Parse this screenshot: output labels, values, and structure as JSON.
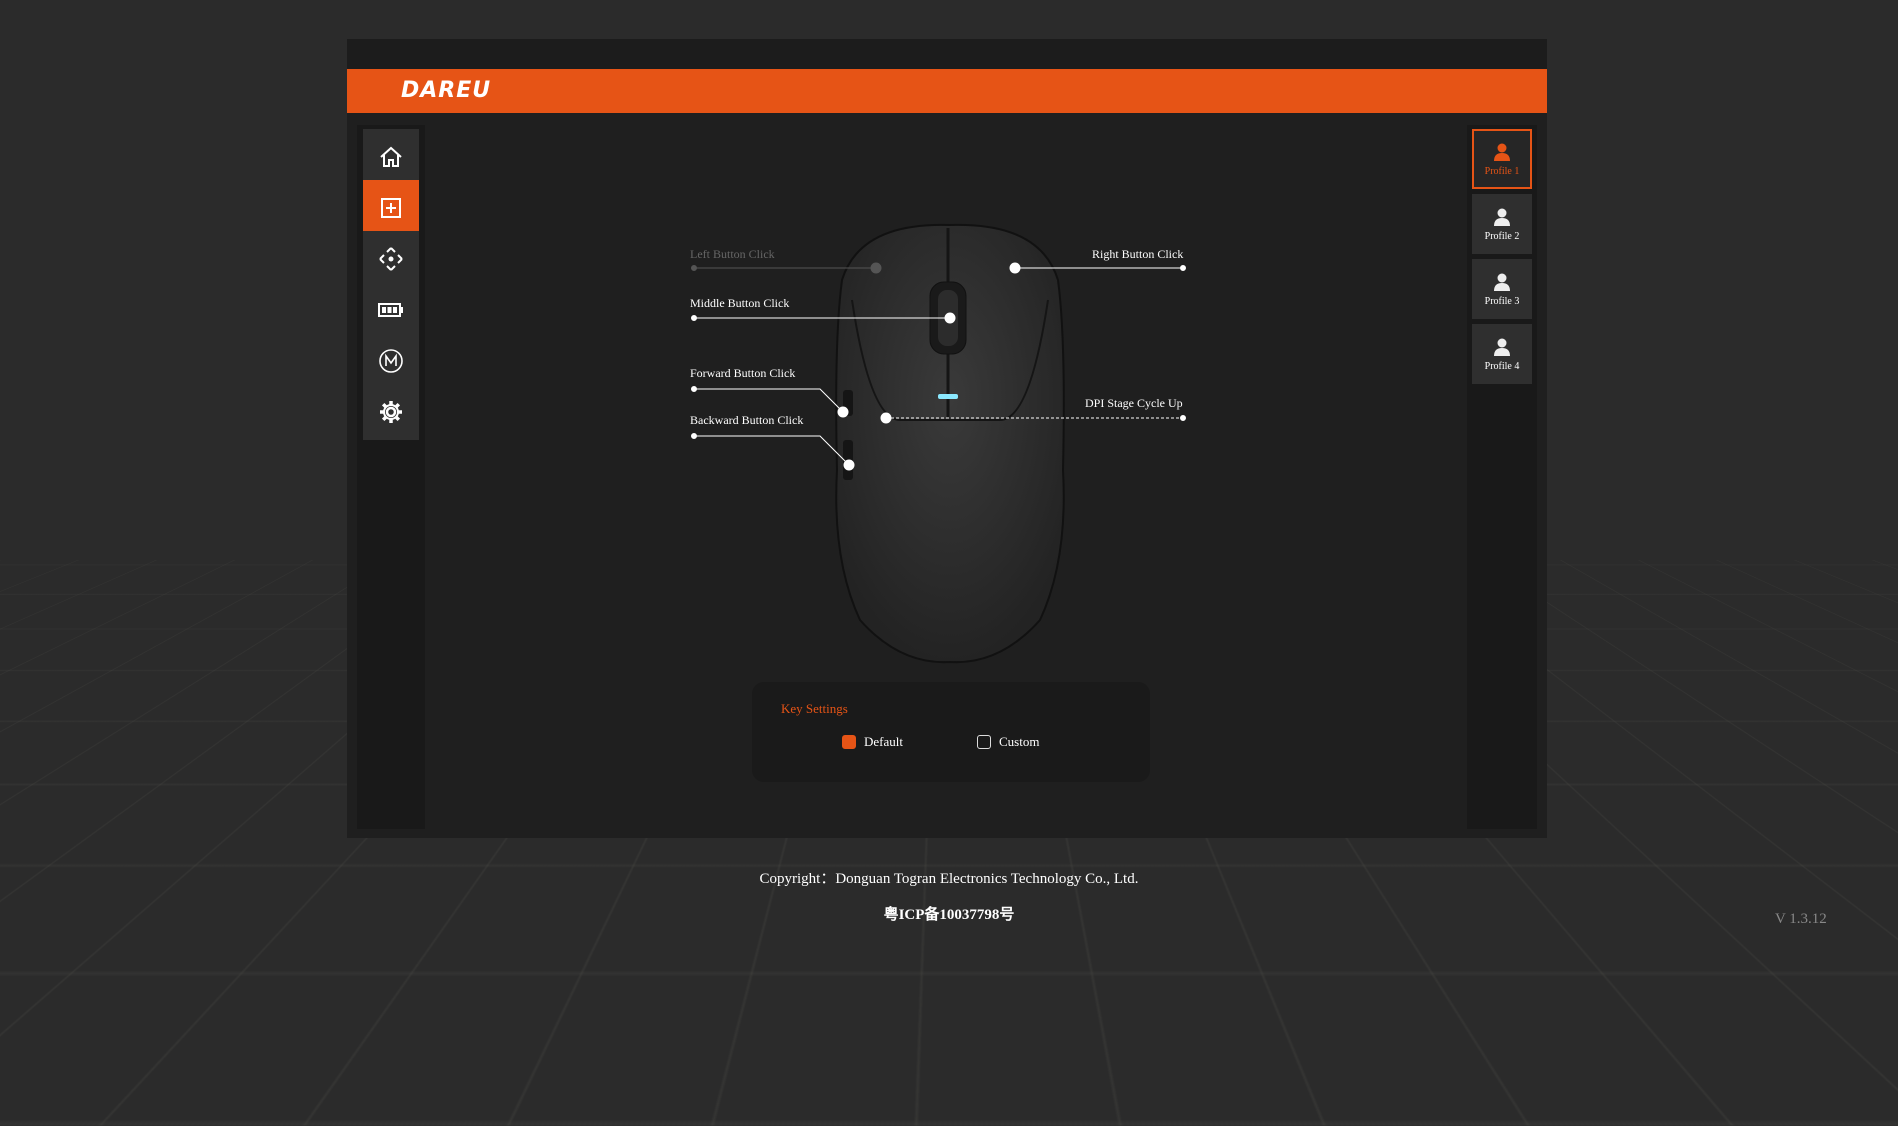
{
  "brand": {
    "logo_text": "DAREU",
    "accent_color": "#e65416"
  },
  "left_nav": [
    {
      "name": "home-icon",
      "active": false
    },
    {
      "name": "key-assign-icon",
      "active": true
    },
    {
      "name": "dpi-icon",
      "active": false
    },
    {
      "name": "battery-icon",
      "active": false
    },
    {
      "name": "macro-icon",
      "active": false
    },
    {
      "name": "settings-icon",
      "active": false
    }
  ],
  "profiles": [
    {
      "label": "Profile 1",
      "active": true
    },
    {
      "label": "Profile 2",
      "active": false
    },
    {
      "label": "Profile 3",
      "active": false
    },
    {
      "label": "Profile 4",
      "active": false
    }
  ],
  "buttons": {
    "left": "Left Button Click",
    "right": "Right Button Click",
    "middle": "Middle Button Click",
    "forward": "Forward Button Click",
    "backward": "Backward Button Click",
    "dpi": "DPI Stage Cycle Up"
  },
  "key_settings": {
    "title": "Key Settings",
    "default_label": "Default",
    "custom_label": "Custom",
    "selected": "Default"
  },
  "footer": {
    "copyright": "Copyright：Donguan Togran Electronics Technology Co., Ltd.",
    "icp": "粤ICP备10037798号",
    "version": "V 1.3.12"
  }
}
